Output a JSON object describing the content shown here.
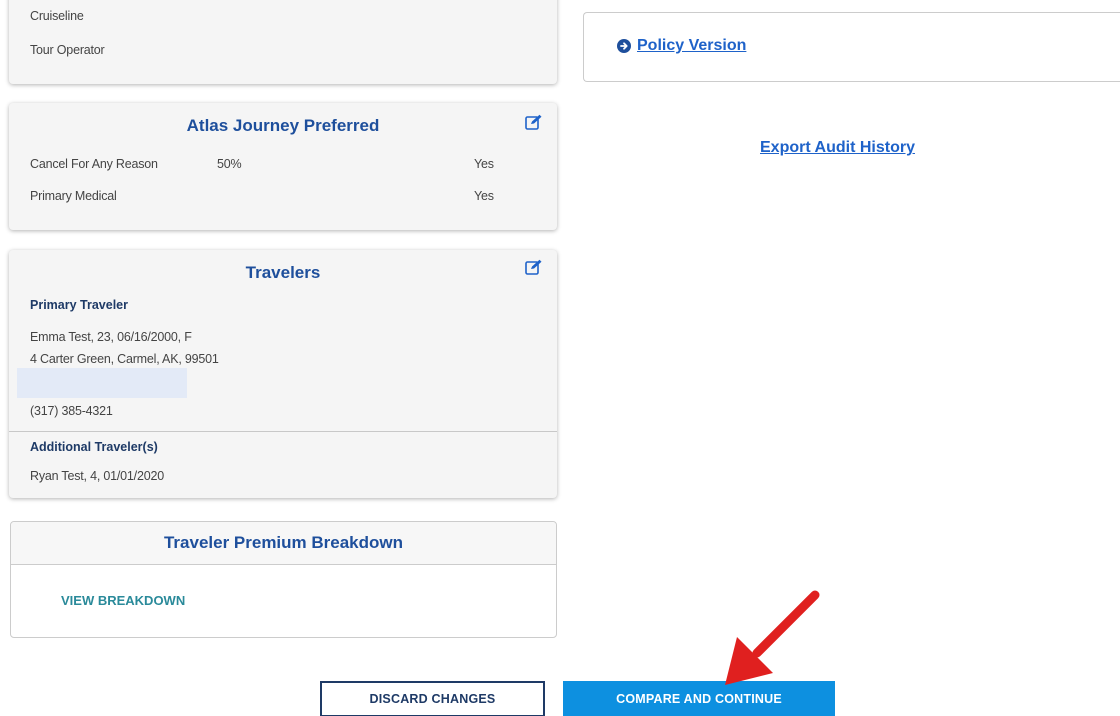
{
  "trip_card": {
    "rows": [
      "Cruiseline",
      "Tour Operator"
    ]
  },
  "policy_card": {
    "link_label": "Policy Version"
  },
  "export_link": "Export Audit History",
  "coverage_card": {
    "title": "Atlas Journey Preferred",
    "rows": [
      {
        "label": "Cancel For Any Reason",
        "value": "50%",
        "status": "Yes"
      },
      {
        "label": "Primary Medical",
        "value": "",
        "status": "Yes"
      }
    ]
  },
  "travelers_card": {
    "title": "Travelers",
    "primary_heading": "Primary Traveler",
    "primary_lines": [
      "Emma Test, 23, 06/16/2000, F",
      "4 Carter Green, Carmel, AK, 99501"
    ],
    "phone": "(317) 385-4321",
    "additional_heading": "Additional Traveler(s)",
    "additional_lines": [
      "Ryan Test, 4, 01/01/2020"
    ]
  },
  "premium_card": {
    "title": "Traveler Premium Breakdown",
    "link_label": "VIEW BREAKDOWN"
  },
  "buttons": {
    "discard": "DISCARD CHANGES",
    "compare": "COMPARE AND CONTINUE"
  },
  "colors": {
    "title_blue": "#1e4f9c",
    "link_blue": "#1e62c9",
    "teal_link": "#2a8a9a",
    "primary_button": "#0d90e0",
    "annotation_arrow": "#e0201f"
  },
  "icons": [
    "arrow-circle-right-icon",
    "edit-icon",
    "red-arrow-annotation"
  ]
}
